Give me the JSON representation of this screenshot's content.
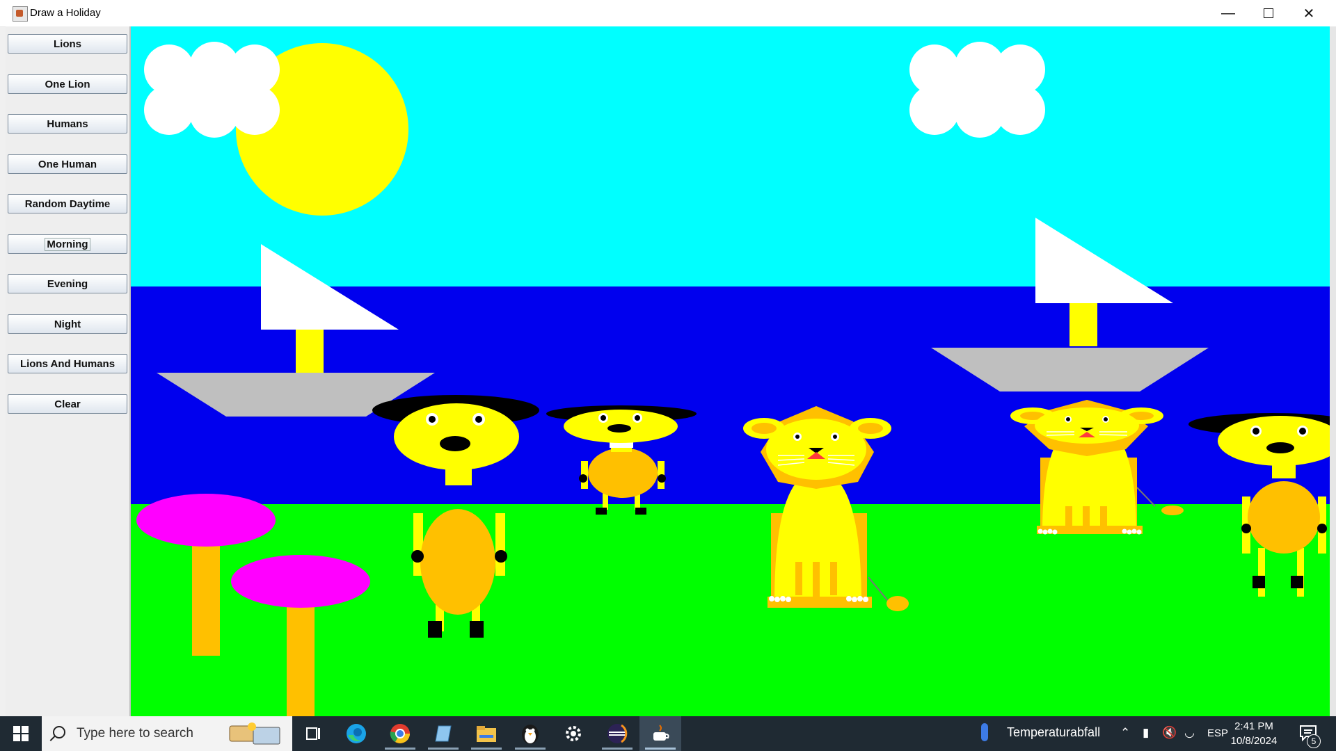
{
  "window": {
    "title": "Draw a Holiday"
  },
  "sidebar": {
    "buttons": [
      {
        "label": "Lions"
      },
      {
        "label": "One Lion"
      },
      {
        "label": "Humans"
      },
      {
        "label": "One Human"
      },
      {
        "label": "Random Daytime"
      },
      {
        "label": "Morning"
      },
      {
        "label": "Evening"
      },
      {
        "label": "Night"
      },
      {
        "label": "Lions And Humans"
      },
      {
        "label": "Clear"
      }
    ],
    "focused": "Morning"
  },
  "scene": {
    "sky_color": "#00ffff",
    "sea_color": "#0000ee",
    "grass_color": "#00ff00",
    "sun_color": "#ffff00",
    "cloud_color": "#ffffff",
    "sail_color": "#ffffff",
    "hull_color": "#bfbfbf",
    "mast_color": "#ffff00",
    "mushroom_cap_color": "#ff00ff",
    "mushroom_stem_color": "#ffc000",
    "lion_color": "#ffff00",
    "lion_mane_color": "#ffc000",
    "human_head_color": "#ffff00",
    "human_body_color": "#ffc000",
    "hair_color": "#000000"
  },
  "taskbar": {
    "search_placeholder": "Type here to search",
    "weather": "Temperaturabfall",
    "language": "ESP",
    "time": "2:41 PM",
    "date": "10/8/2024",
    "notification_count": "5",
    "icons": [
      "task-view-icon",
      "edge-icon",
      "chrome-icon",
      "notepad-icon",
      "file-explorer-icon",
      "penguin-app-icon",
      "settings-icon",
      "eclipse-icon",
      "java-icon"
    ]
  }
}
